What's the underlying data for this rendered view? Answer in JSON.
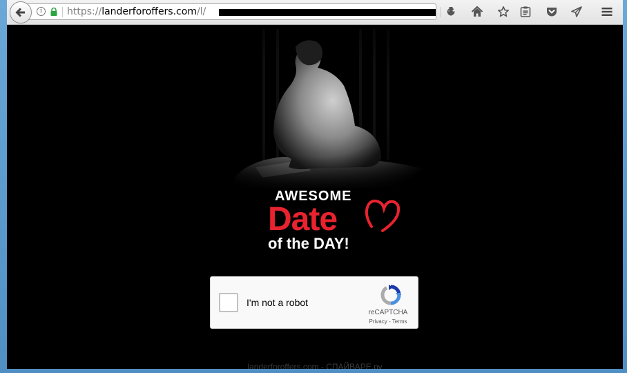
{
  "browser": {
    "url": {
      "scheme": "https://",
      "host": "landerforoffers.com",
      "path": "/l/"
    },
    "icons": {
      "back": "back-arrow-icon",
      "info": "info-icon",
      "lock": "lock-icon",
      "reload": "reload-icon",
      "download": "download-icon",
      "home": "home-icon",
      "bookmark": "star-icon",
      "reading_list": "reading-list-icon",
      "pocket": "pocket-icon",
      "send": "send-tab-icon",
      "menu": "hamburger-menu-icon"
    },
    "info_glyph": "i"
  },
  "page": {
    "logo": {
      "line1": "AWESOME",
      "line2": "Date",
      "line3": "of the DAY!"
    },
    "recaptcha": {
      "label": "I'm not a robot",
      "brand": "reCAPTCHA",
      "privacy": "Privacy",
      "separator": " - ",
      "terms": "Terms"
    },
    "watermark": "landerforoffers.com - СПАЙВАРЕ.ру"
  },
  "colors": {
    "background": "#000000",
    "logo_red": "#e8232f",
    "lock_green": "#2aa53f",
    "recaptcha_blue": "#4a90e2"
  }
}
